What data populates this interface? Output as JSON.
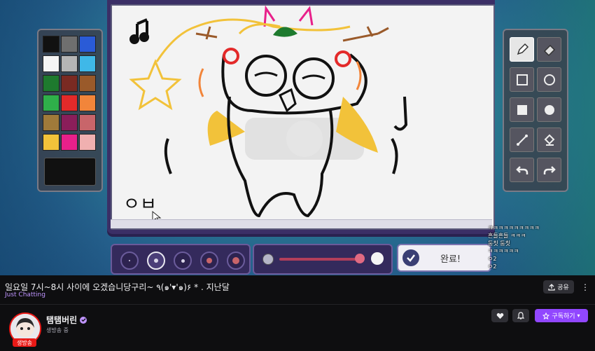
{
  "palette": {
    "colors": [
      "#111111",
      "#6f6f6f",
      "#2a5bd7",
      "#f5f5f5",
      "#b5b5b5",
      "#3fb8e8",
      "#1e7a2e",
      "#7a2a22",
      "#9a5a2a",
      "#2fb04a",
      "#e32a2a",
      "#f2853a",
      "#a07a3a",
      "#8a1e5a",
      "#c8656a",
      "#f2c23a",
      "#e8208a",
      "#f0b0b0"
    ]
  },
  "tools": {
    "items": [
      "pencil-icon",
      "eraser-icon",
      "square-outline-icon",
      "circle-outline-icon",
      "square-filled-icon",
      "circle-filled-icon",
      "line-icon",
      "fill-bucket-icon",
      "undo-icon",
      "redo-icon"
    ]
  },
  "drawing": {
    "text_hangul": "ㅇㅂ"
  },
  "done_button": {
    "label": "완료!"
  },
  "chat": {
    "lines": [
      "ㅋㅋㅋㅋㅋㅋㅋㅋㅋㅋ",
      "흔들흔들 ㅋㅋㅋ",
      "둠칫 둠칫",
      "ㅋㅋㅋㅋㅋㅋ",
      "ㅇ2",
      "ㅇ2"
    ]
  },
  "stream_info": {
    "title": "일요일 7시~8시 사이에 오겠습니당구리~ ٩(๑'▾'๑)۶ * . 지난달",
    "category": "Just Chatting",
    "share_label": "공유",
    "channel_name": "탬탬버린",
    "status": "생방송 중",
    "live_badge": "생방송",
    "subscribe_label": "구독하기"
  }
}
